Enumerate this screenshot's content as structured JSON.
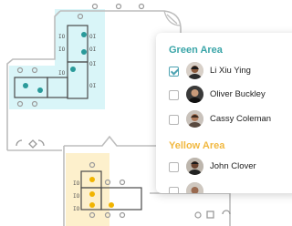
{
  "colors": {
    "green_zone": "#d9f5f8",
    "yellow_zone": "#fdf0cc",
    "green_title": "#3aa5a8",
    "yellow_title": "#f1b840",
    "seat_teal": "#2a9a9a",
    "seat_yellow": "#f1b400",
    "wall": "#bdbdbd",
    "checkbox_accent": "#4ea3b2"
  },
  "panel": {
    "sections": [
      {
        "title": "Green Area",
        "color_key": "green_title",
        "people": [
          {
            "name": "Li Xiu Ying",
            "checked": true
          },
          {
            "name": "Oliver Buckley",
            "checked": false
          },
          {
            "name": "Cassy Coleman",
            "checked": false
          }
        ]
      },
      {
        "title": "Yellow Area",
        "color_key": "yellow_title",
        "people": [
          {
            "name": "John Clover",
            "checked": false
          },
          {
            "name": "",
            "checked": false
          }
        ]
      }
    ]
  }
}
